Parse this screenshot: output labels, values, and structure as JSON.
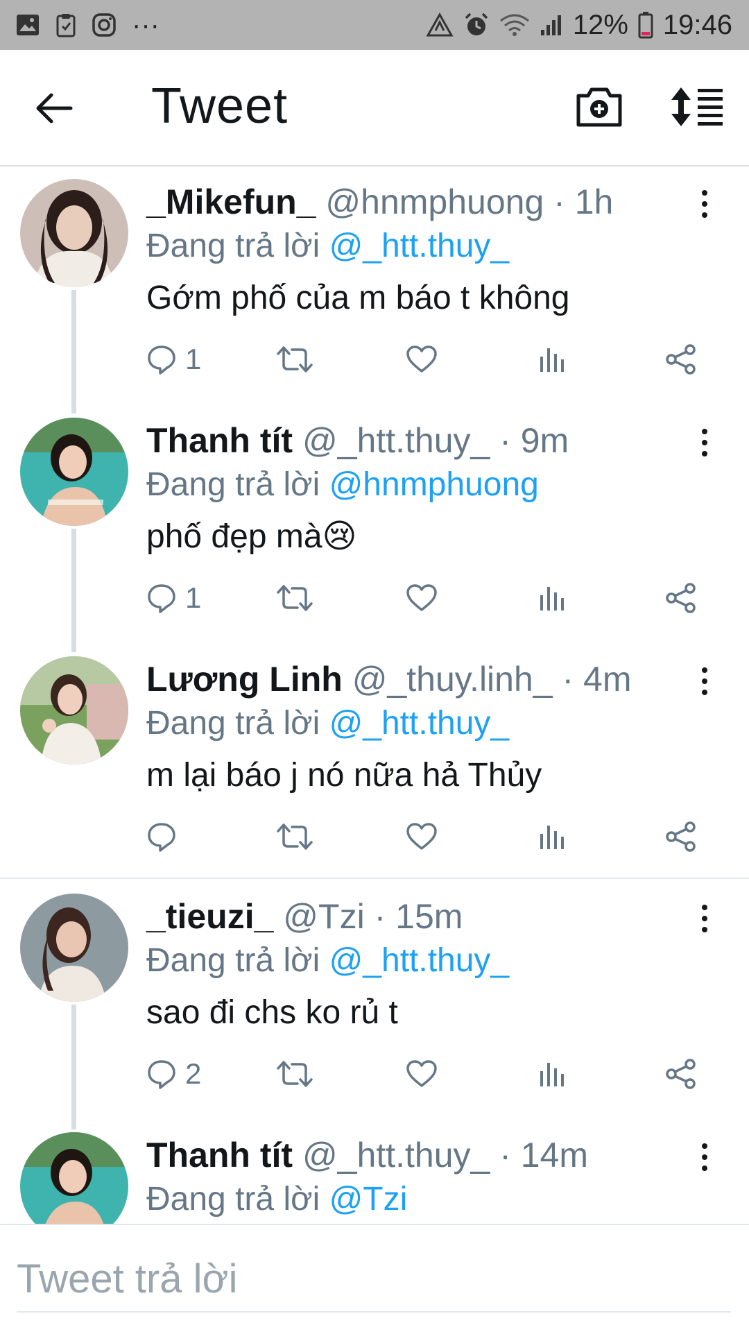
{
  "status_bar": {
    "battery": "12%",
    "time": "19:46",
    "more": "···"
  },
  "header": {
    "title": "Tweet"
  },
  "tweets": [
    {
      "name": "_Mikefun_",
      "meta": " @hnmphuong · 1h",
      "reply_prefix": "Đang trả lời ",
      "reply_to": "@_htt.thuy_",
      "text": "Gớm phố của m báo t không",
      "reply_count": "1"
    },
    {
      "name": "Thanh tít",
      "meta": " @_htt.thuy_ · 9m",
      "reply_prefix": "Đang trả lời ",
      "reply_to": "@hnmphuong",
      "text": "phố đẹp mà😢",
      "reply_count": "1"
    },
    {
      "name": "Lương Linh",
      "meta": " @_thuy.linh_ · 4m",
      "reply_prefix": "Đang trả lời ",
      "reply_to": "@_htt.thuy_",
      "text": "m lại báo j nó nữa hả Thủy",
      "reply_count": ""
    },
    {
      "name": "_tieuzi_",
      "meta": " @Tzi · 15m",
      "reply_prefix": "Đang trả lời ",
      "reply_to": "@_htt.thuy_",
      "text": "sao đi chs ko rủ t",
      "reply_count": "2"
    },
    {
      "name": "Thanh tít",
      "meta": " @_htt.thuy_ · 14m",
      "reply_prefix": "Đang trả lời ",
      "reply_to": "@Tzi",
      "text": "",
      "reply_count": ""
    }
  ],
  "reply_bar": {
    "placeholder": "Tweet trả lời"
  },
  "colors": {
    "accent": "#1da1f2",
    "muted": "#657786",
    "status_bar": "#b3b3b3"
  }
}
